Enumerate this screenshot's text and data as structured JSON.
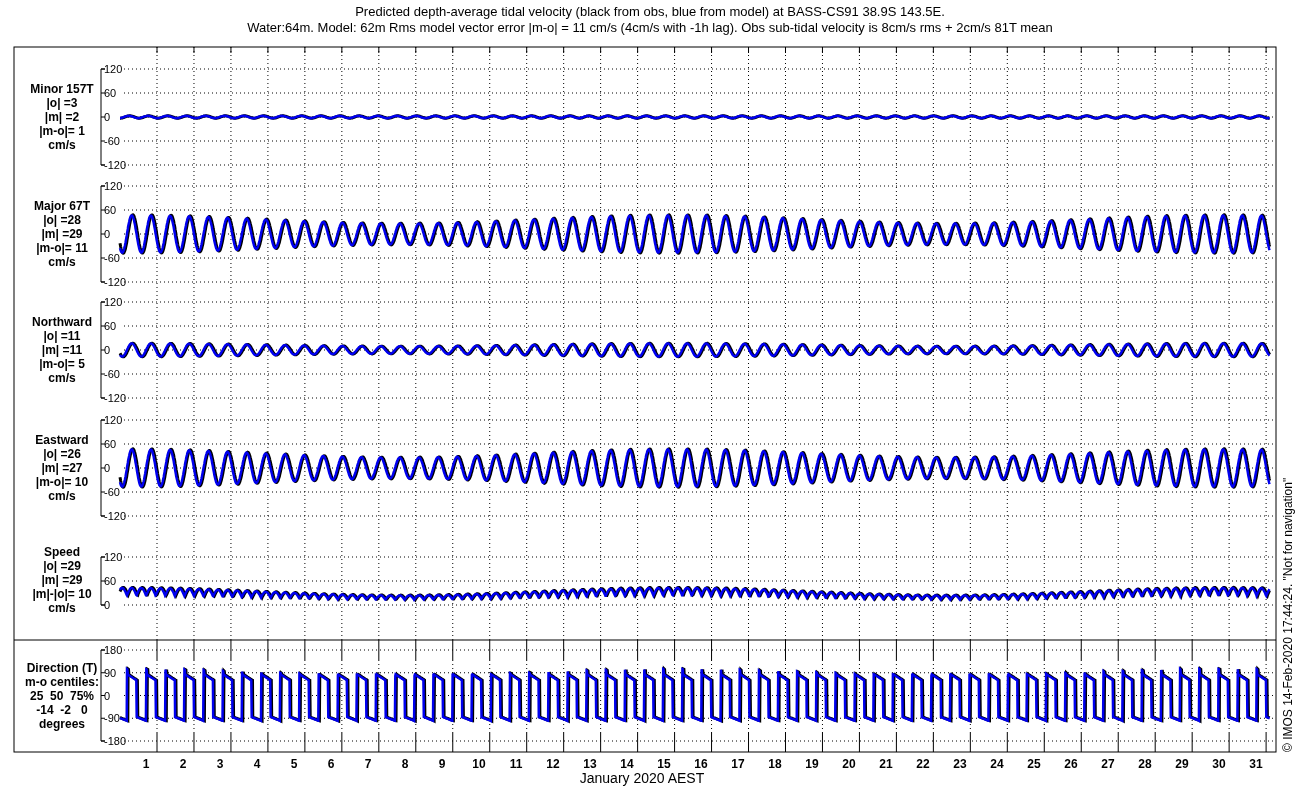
{
  "title": "Predicted depth-average tidal velocity (black from obs, blue from model) at BASS-CS91 38.9S 143.5E.",
  "subtitle": "Water:64m. Model: 62m  Rms model vector error |m-o| = 11 cm/s (4cm/s with -1h lag). Obs sub-tidal velocity is 8cm/s rms + 2cm/s 81T mean",
  "panels": [
    {
      "kind": "wave_small",
      "label_lines": [
        "Minor 157T",
        "|o| =3",
        "|m| =2",
        "|m-o|= 1",
        "cm/s"
      ],
      "yticks": [
        "120",
        "60",
        "0",
        "-60",
        "-120"
      ]
    },
    {
      "kind": "wave_large",
      "label_lines": [
        "Major 67T",
        "|o| =28",
        "|m| =29",
        "|m-o|= 11",
        "cm/s"
      ],
      "yticks": [
        "120",
        "60",
        "0",
        "-60",
        "-120"
      ]
    },
    {
      "kind": "wave_medium",
      "label_lines": [
        "Northward",
        "|o| =11",
        "|m| =11",
        "|m-o|= 5",
        "cm/s"
      ],
      "yticks": [
        "120",
        "60",
        "0",
        "-60",
        "-120"
      ]
    },
    {
      "kind": "wave_large",
      "label_lines": [
        "Eastward",
        "|o| =26",
        "|m| =27",
        "|m-o|= 10",
        "cm/s"
      ],
      "yticks": [
        "120",
        "60",
        "0",
        "-60",
        "-120"
      ]
    },
    {
      "kind": "speed",
      "label_lines": [
        "Speed",
        "|o| =29",
        "|m| =29",
        "|m|-|o|= 10",
        "cm/s"
      ],
      "yticks": [
        "120",
        "60",
        "0"
      ]
    },
    {
      "kind": "direction",
      "label_lines": [
        "Direction (T)",
        "m-o centiles:",
        "25  50  75%",
        "-14  -2   0",
        "degrees"
      ],
      "yticks": [
        "180",
        "90",
        "0",
        "-90",
        "-180"
      ]
    }
  ],
  "x_axis": {
    "ticks": [
      "1",
      "2",
      "3",
      "4",
      "5",
      "6",
      "7",
      "8",
      "9",
      "10",
      "11",
      "12",
      "13",
      "14",
      "15",
      "16",
      "17",
      "18",
      "19",
      "20",
      "21",
      "22",
      "23",
      "24",
      "25",
      "26",
      "27",
      "28",
      "29",
      "30",
      "31"
    ],
    "label": "January 2020 AEST"
  },
  "side_note": "© IMOS 14-Feb-2020 17:44:24. \"Not for navigation\""
}
